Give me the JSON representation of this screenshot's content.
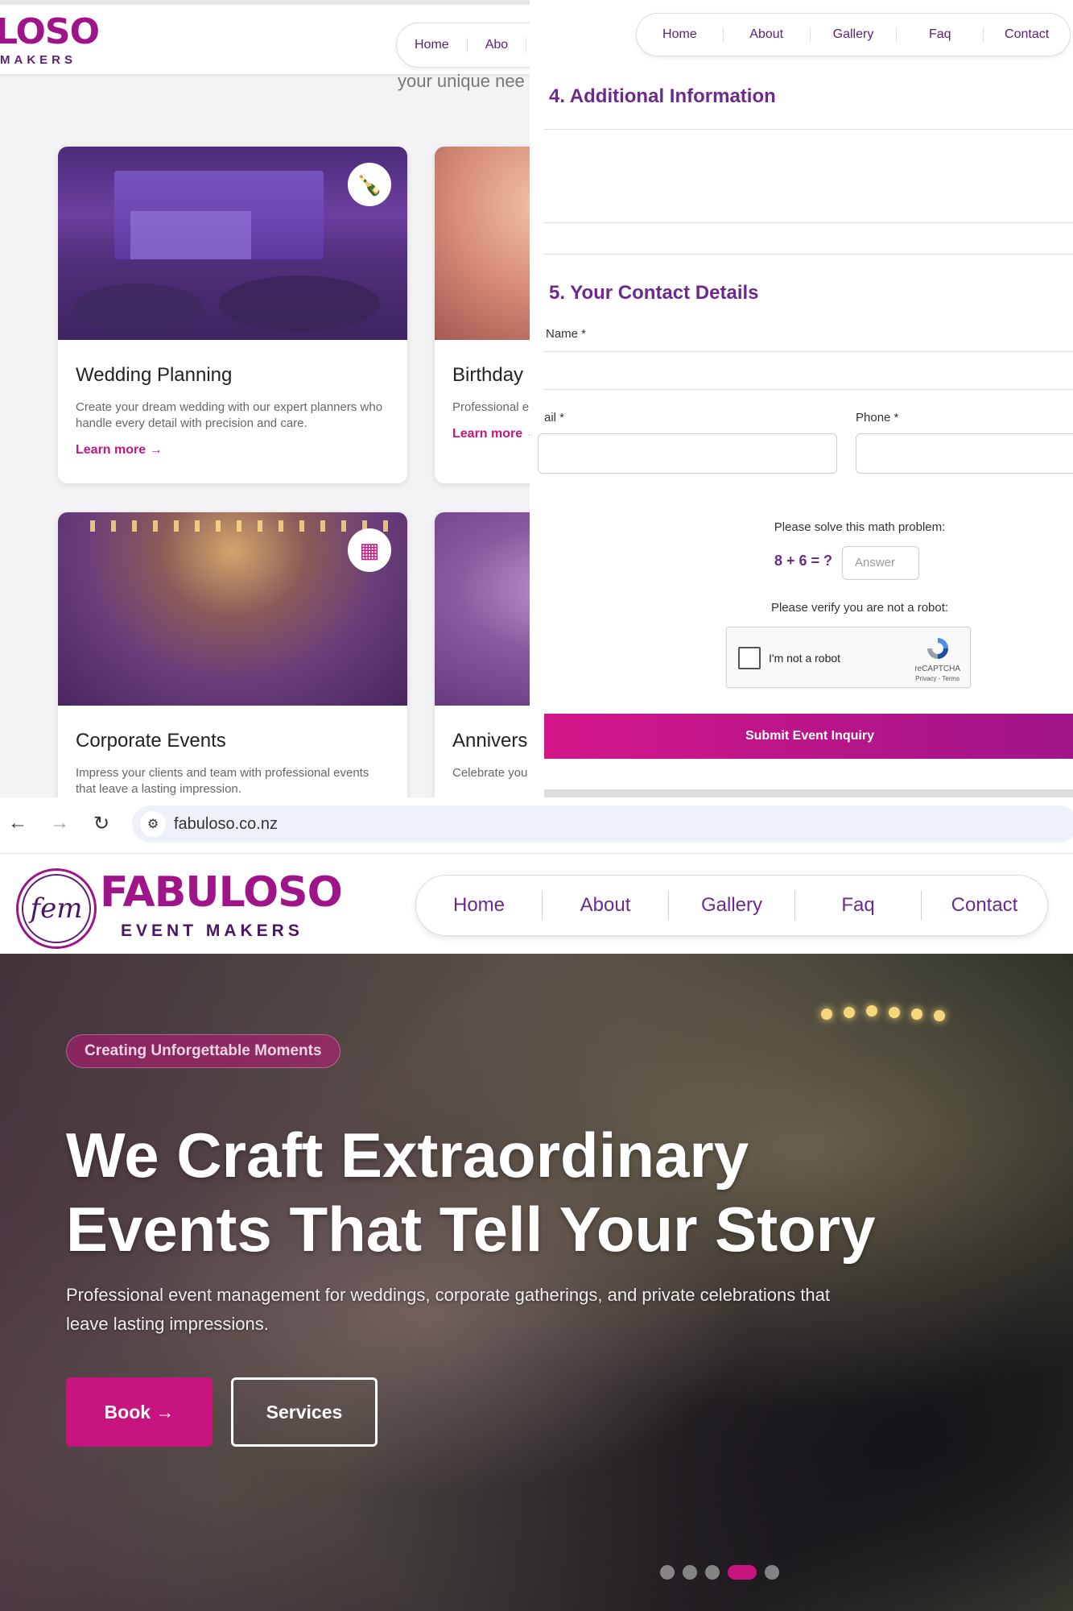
{
  "top_left": {
    "logo_partial": "LOSO",
    "logo_sub_partial": "MAKERS",
    "nav": [
      "Home",
      "Abo"
    ],
    "intro_tail": "your unique nee",
    "cards": [
      {
        "title": "Wedding Planning",
        "desc": "Create your dream wedding with our expert planners who handle every detail with precision and care.",
        "link": "Learn more",
        "icon": "champagne-glasses-icon"
      },
      {
        "title": "Birthday",
        "desc": "Professional e with unforgett",
        "link": "Learn more"
      },
      {
        "title": "Corporate Events",
        "desc": "Impress your clients and team with professional events that leave a lasting impression.",
        "link": "",
        "icon": "building-icon"
      },
      {
        "title": "Annivers",
        "desc": "Celebrate you personalized",
        "link": ""
      }
    ]
  },
  "form": {
    "nav": [
      "Home",
      "About",
      "Gallery",
      "Faq",
      "Contact"
    ],
    "section4_title": "4. Additional Information",
    "section5_title": "5. Your Contact Details",
    "name_label": "Name *",
    "email_label": "ail *",
    "phone_label": "Phone *",
    "math_prompt": "Please solve this math problem:",
    "math_question": "8 + 6 = ?",
    "math_placeholder": "Answer",
    "robot_prompt": "Please verify you are not a robot:",
    "captcha_label": "I'm not a robot",
    "captcha_brand": "reCAPTCHA",
    "captcha_links": "Privacy - Terms",
    "submit_label": "Submit Event Inquiry"
  },
  "browser": {
    "url": "fabuloso.co.nz"
  },
  "header": {
    "logo_mark": "fem",
    "logo_name": "FABULOSO",
    "logo_tagline": "EVENT MAKERS",
    "nav": [
      "Home",
      "About",
      "Gallery",
      "Faq",
      "Contact"
    ]
  },
  "hero": {
    "badge": "Creating Unforgettable Moments",
    "title_line1": "We Craft Extraordinary",
    "title_line2": "Events That Tell Your Story",
    "description": "Professional event management for weddings, corporate gatherings, and private celebrations that leave lasting impressions.",
    "book_label": "Book",
    "services_label": "Services",
    "slide_count": 5,
    "active_slide": 4
  },
  "colors": {
    "brand_magenta": "#c8147f",
    "brand_purple": "#6b2a8c"
  }
}
